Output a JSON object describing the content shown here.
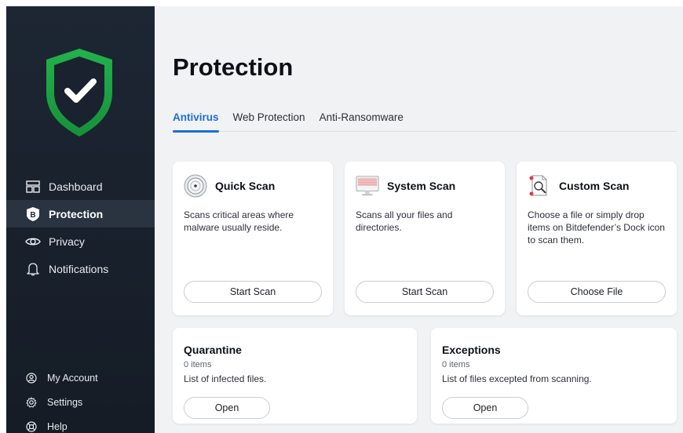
{
  "sidebar": {
    "nav": [
      {
        "label": "Dashboard",
        "icon": "dashboard-icon"
      },
      {
        "label": "Protection",
        "icon": "bitdefender-b-icon",
        "active": true
      },
      {
        "label": "Privacy",
        "icon": "eye-icon"
      },
      {
        "label": "Notifications",
        "icon": "bell-icon"
      }
    ],
    "bottom": [
      {
        "label": "My Account",
        "icon": "account-icon"
      },
      {
        "label": "Settings",
        "icon": "gear-icon"
      },
      {
        "label": "Help",
        "icon": "help-icon"
      }
    ]
  },
  "main": {
    "title": "Protection",
    "tabs": [
      {
        "label": "Antivirus",
        "active": true
      },
      {
        "label": "Web Protection"
      },
      {
        "label": "Anti-Ransomware"
      }
    ],
    "scans": [
      {
        "title": "Quick Scan",
        "desc": "Scans critical areas where malware usually reside.",
        "button": "Start Scan",
        "icon": "quick-scan-icon"
      },
      {
        "title": "System Scan",
        "desc": "Scans all your files and directories.",
        "button": "Start Scan",
        "icon": "system-scan-icon"
      },
      {
        "title": "Custom Scan",
        "desc": "Choose a file or simply drop items on Bitdefender’s Dock icon to scan them.",
        "button": "Choose File",
        "icon": "custom-scan-icon"
      }
    ],
    "quarantine": {
      "title": "Quarantine",
      "count": "0 items",
      "desc": "List of infected files.",
      "button": "Open"
    },
    "exceptions": {
      "title": "Exceptions",
      "count": "0 items",
      "desc": "List of files excepted from scanning.",
      "button": "Open"
    }
  },
  "colors": {
    "accent": "#1a6fd6",
    "shield": "#1fb14a",
    "sidebar": "#1d2633"
  }
}
